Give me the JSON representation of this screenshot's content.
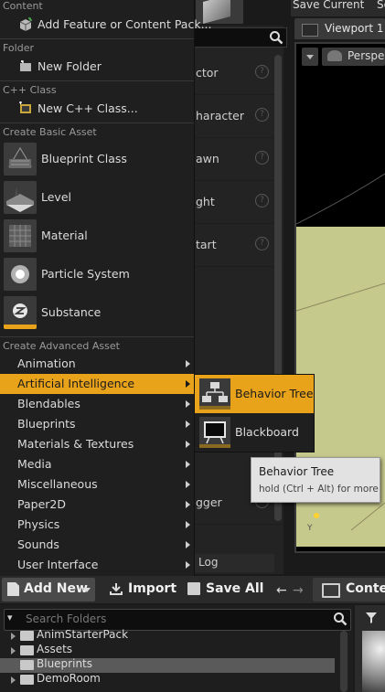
{
  "background": {
    "asset_list_fragments": [
      "ctor",
      "haracter",
      "awn",
      "ght",
      "tart"
    ],
    "asset_list_lower_fragments": [
      "gger"
    ],
    "log_tab_label": "Log",
    "viewport_tab_label": "Viewport 1",
    "viewport_save_label": "Save Current",
    "viewport_save_cut": "Se",
    "viewport_perspective_label": "Perspec"
  },
  "context_menu": {
    "sections": {
      "content": "Content",
      "folder": "Folder",
      "cpp_class": "C++ Class",
      "basic_asset": "Create Basic Asset",
      "advanced_asset": "Create Advanced Asset"
    },
    "add_feature_label": "Add Feature or Content Pack...",
    "new_folder_label": "New Folder",
    "new_cpp_class_label": "New C++ Class...",
    "basic_assets": [
      {
        "label": "Blueprint Class",
        "icon": "blueprint-class-icon"
      },
      {
        "label": "Level",
        "icon": "level-icon"
      },
      {
        "label": "Material",
        "icon": "material-icon"
      },
      {
        "label": "Particle System",
        "icon": "particle-system-icon"
      },
      {
        "label": "Substance",
        "icon": "substance-icon"
      }
    ],
    "advanced_assets": [
      {
        "label": "Animation"
      },
      {
        "label": "Artificial Intelligence",
        "active": true
      },
      {
        "label": "Blendables"
      },
      {
        "label": "Blueprints"
      },
      {
        "label": "Materials & Textures"
      },
      {
        "label": "Media"
      },
      {
        "label": "Miscellaneous"
      },
      {
        "label": "Paper2D"
      },
      {
        "label": "Physics"
      },
      {
        "label": "Sounds"
      },
      {
        "label": "User Interface"
      }
    ]
  },
  "submenu": {
    "items": [
      {
        "label": "Behavior Tree",
        "icon": "behavior-tree-icon",
        "active": true
      },
      {
        "label": "Blackboard",
        "icon": "blackboard-icon",
        "active": false
      }
    ]
  },
  "tooltip": {
    "title": "Behavior Tree",
    "hint": "hold (Ctrl + Alt) for more"
  },
  "toolbar": {
    "add_new_label": "Add New",
    "import_label": "Import",
    "save_all_label": "Save All",
    "content_label": "Conten"
  },
  "folder_tree": {
    "search_placeholder": "Search Folders",
    "folders": [
      {
        "label": "AnimStarterPack",
        "selected": false
      },
      {
        "label": "Assets",
        "selected": false
      },
      {
        "label": "Blueprints",
        "selected": true
      },
      {
        "label": "DemoRoom",
        "selected": false
      }
    ]
  },
  "colors": {
    "accent_highlight": "#e8a31a",
    "menu_background": "#1f1f1f",
    "viewport_ground": "#c6c98c"
  }
}
